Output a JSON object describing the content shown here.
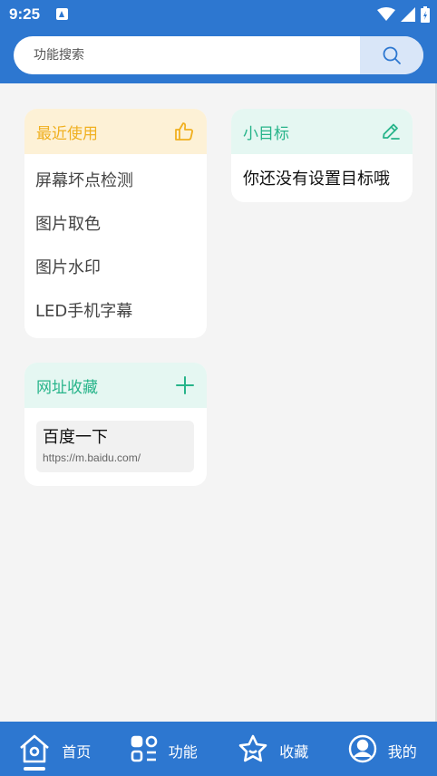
{
  "status_bar": {
    "time": "9:25"
  },
  "search": {
    "placeholder": "功能搜索"
  },
  "recent": {
    "title": "最近使用",
    "items": [
      "屏幕坏点检测",
      "图片取色",
      "图片水印",
      "LED手机字幕"
    ]
  },
  "goal": {
    "title": "小目标",
    "empty_text": "你还没有设置目标哦"
  },
  "bookmarks": {
    "title": "网址收藏",
    "items": [
      {
        "name": "百度一下",
        "url": "https://m.baidu.com/"
      }
    ]
  },
  "tabs": [
    {
      "label": "首页",
      "icon": "home-icon"
    },
    {
      "label": "功能",
      "icon": "grid-icon"
    },
    {
      "label": "收藏",
      "icon": "star-icon"
    },
    {
      "label": "我的",
      "icon": "user-icon"
    }
  ],
  "colors": {
    "primary": "#2d77d0",
    "recent_accent": "#f0b020",
    "green_accent": "#27b48a",
    "background": "#f4f4f4"
  }
}
